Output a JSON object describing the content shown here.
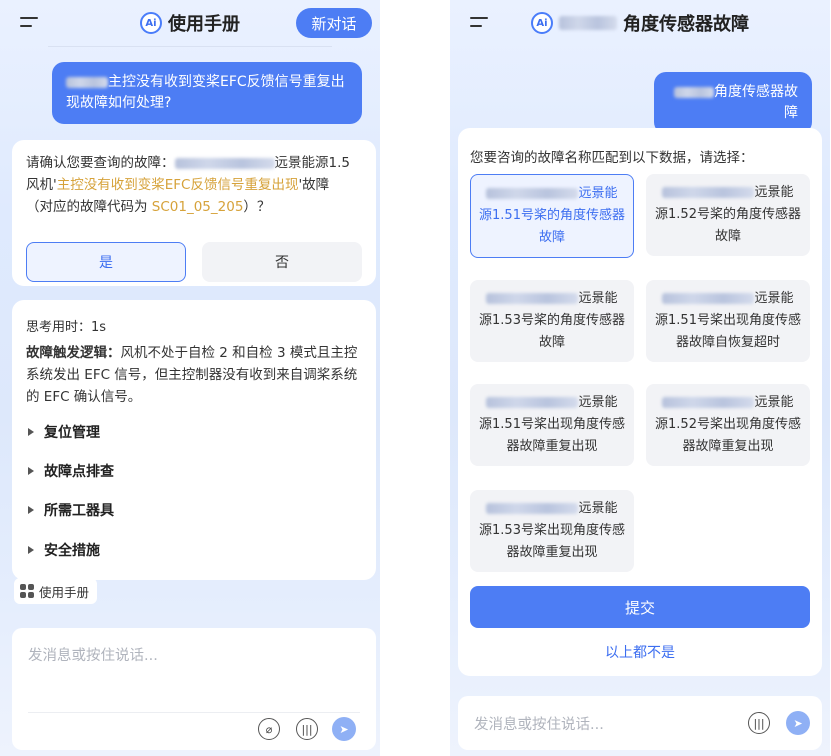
{
  "left": {
    "header": {
      "title": "使用手册",
      "new_chat_label": "新对话",
      "ai_badge": "Ai"
    },
    "user_message": "主控没有收到变桨EFC反馈信号重复出现故障如何处理?",
    "confirm": {
      "prefix": "请确认您要查询的故障：",
      "model_suffix": "远景能源1.5",
      "line2_prefix": "风机'",
      "fault_name": "主控没有收到变桨EFC反馈信号重复出现",
      "line2_suffix": "'故障",
      "code_prefix": "（对应的故障代码为 ",
      "code": "SC01_05_205",
      "code_suffix": "）？",
      "yes_label": "是",
      "no_label": "否"
    },
    "thinking": {
      "time_label": "思考用时：1s",
      "logic_title": "故障触发逻辑：",
      "logic_text": "风机不处于自检 2 和自检 3 模式且主控系统发出 EFC 信号，但主控制器没有收到来自调桨系统的 EFC 确认信号。",
      "sections": [
        "复位管理",
        "故障点排查",
        "所需工器具",
        "安全措施"
      ]
    },
    "manual_tag": "使用手册",
    "input_placeholder": "发消息或按住说话..."
  },
  "right": {
    "header": {
      "title": "角度传感器故障",
      "ai_badge": "Ai"
    },
    "user_message": "角度传感器故障",
    "choose_title": "您要咨询的故障名称匹配到以下数据，请选择：",
    "options": [
      {
        "line1": "远景能",
        "rest": "源1.51号桨的角度传感器故障"
      },
      {
        "line1": "远景能",
        "rest": "源1.52号桨的角度传感器故障"
      },
      {
        "line1": "远景能",
        "rest": "源1.53号桨的角度传感器故障"
      },
      {
        "line1": "远景能",
        "rest": "源1.51号桨出现角度传感器故障自恢复超时"
      },
      {
        "line1": "远景能",
        "rest": "源1.51号桨出现角度传感器故障重复出现"
      },
      {
        "line1": "远景能",
        "rest": "源1.52号桨出现角度传感器故障重复出现"
      },
      {
        "line1": "远景能",
        "rest": "源1.53号桨出现角度传感器故障重复出现"
      }
    ],
    "submit_label": "提交",
    "none_label": "以上都不是",
    "input_placeholder": "发消息或按住说话..."
  },
  "colors": {
    "accent": "#4d7df4",
    "highlight": "#d6a23a"
  }
}
